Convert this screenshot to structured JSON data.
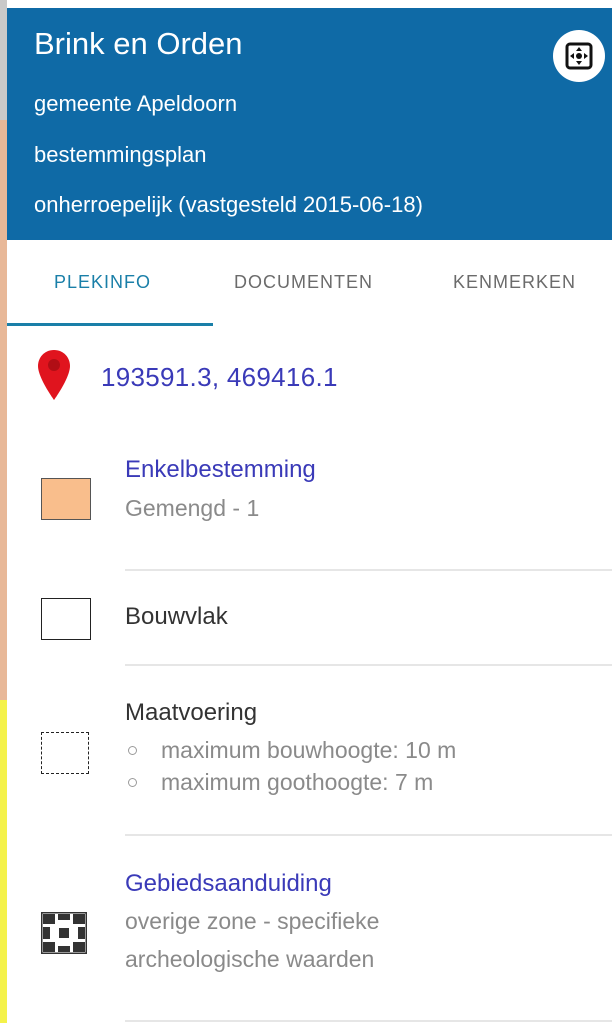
{
  "header": {
    "title": "Brink en Orden",
    "municipality": "gemeente Apeldoorn",
    "plan_type": "bestemmingsplan",
    "status": "onherroepelijk (vastgesteld 2015-06-18)",
    "expand_icon": "expand-icon"
  },
  "tabs": [
    {
      "label": "PLEKINFO",
      "active": true
    },
    {
      "label": "DOCUMENTEN",
      "active": false
    },
    {
      "label": "KENMERKEN",
      "active": false
    }
  ],
  "location": {
    "icon": "map-pin-icon",
    "coordinates": "193591.3, 469416.1"
  },
  "items": [
    {
      "title": "Enkelbestemming",
      "subtitle": "Gemengd - 1",
      "symbol_color": "#f9be8c",
      "link": true
    },
    {
      "title": "Bouwvlak",
      "link": false
    },
    {
      "title": "Maatvoering",
      "bullets": [
        "maximum bouwhoogte: 10 m",
        "maximum goothoogte: 7 m"
      ],
      "link": false
    },
    {
      "title": "Gebiedsaanduiding",
      "subtitle_line1": "overige zone - specifieke",
      "subtitle_line2": "archeologische waarden",
      "link": true
    }
  ],
  "colors": {
    "header_bg": "#0f6aa6",
    "accent": "#1a7fa8",
    "link": "#3a3ab8",
    "pin": "#e0141e"
  }
}
